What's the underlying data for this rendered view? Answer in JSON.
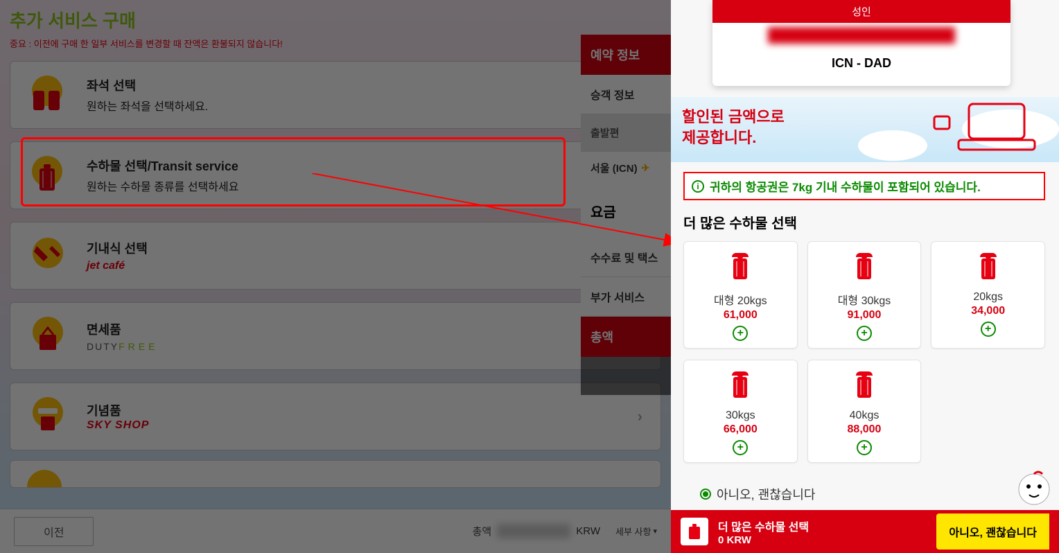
{
  "left": {
    "title": "추가 서비스 구매",
    "warning": "중요 : 이전에 구매 한 일부 서비스를 변경할 때 잔액은 환불되지 않습니다!",
    "services": {
      "seat": {
        "title": "좌석 선택",
        "sub": "원하는 좌석을 선택하세요."
      },
      "baggage": {
        "title": "수하물 선택/Transit service",
        "sub": "원하는 수하물 종류를 선택하세요"
      },
      "meal": {
        "title": "기내식 선택",
        "sub": "jet café"
      },
      "dutyfree": {
        "title": "면세품",
        "sub_prefix": "DUTY",
        "sub_suffix": "FREE"
      },
      "souvenir": {
        "title": "기념품",
        "sub": "SKY SHOP"
      }
    },
    "bottom": {
      "prev": "이전",
      "total_label": "총액",
      "currency": "KRW",
      "detail": "세부 사항"
    }
  },
  "sidebar": {
    "head": "예약 정보",
    "pax": "승객 정보",
    "depart_tab": "출발편",
    "route_from": "서울 (ICN)",
    "fare_label": "요금",
    "fees": "수수료 및 택스",
    "addon": "부가 서비스",
    "total": "총액"
  },
  "right": {
    "psg_label": "성인",
    "route": "ICN - DAD",
    "promo_line1": "할인된 금액으로",
    "promo_line2": "제공합니다.",
    "notice": "귀하의 항공권은 7kg 기내 수하물이 포함되어 있습니다.",
    "more_title": "더 많은 수하물 선택",
    "bags": [
      {
        "label": "대형 20kgs",
        "price": "61,000"
      },
      {
        "label": "대형 30kgs",
        "price": "91,000"
      },
      {
        "label": "20kgs",
        "price": "34,000"
      },
      {
        "label": "30kgs",
        "price": "66,000"
      },
      {
        "label": "40kgs",
        "price": "88,000"
      }
    ],
    "no_thanks": "아니오, 괜찮습니다",
    "footer": {
      "title": "더 많은 수하물 선택",
      "amount": "0 KRW",
      "button": "아니오, 괜찮습니다"
    }
  }
}
